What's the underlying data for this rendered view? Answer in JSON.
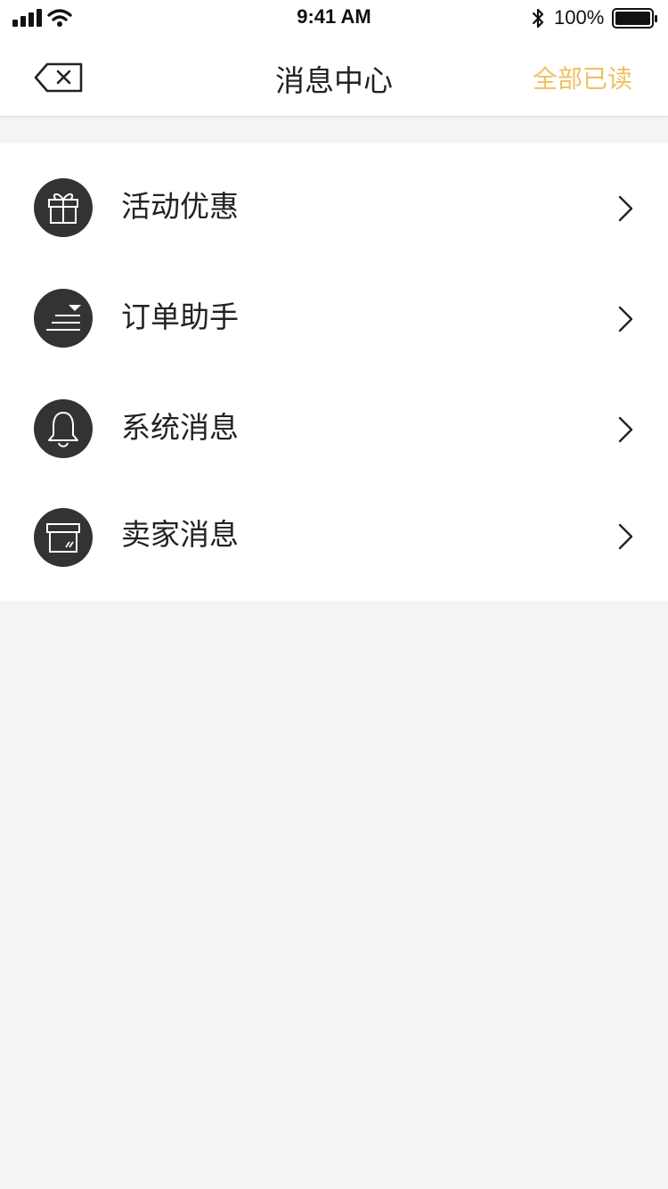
{
  "status_bar": {
    "time": "9:41 AM",
    "battery_percent": "100%"
  },
  "nav": {
    "title": "消息中心",
    "action_label": "全部已读",
    "action_color": "#F0C060"
  },
  "menu": {
    "items": [
      {
        "label": "活动优惠",
        "icon": "gift-icon"
      },
      {
        "label": "订单助手",
        "icon": "order-list-icon"
      },
      {
        "label": "系统消息",
        "icon": "bell-icon"
      },
      {
        "label": "卖家消息",
        "icon": "store-box-icon"
      }
    ]
  }
}
